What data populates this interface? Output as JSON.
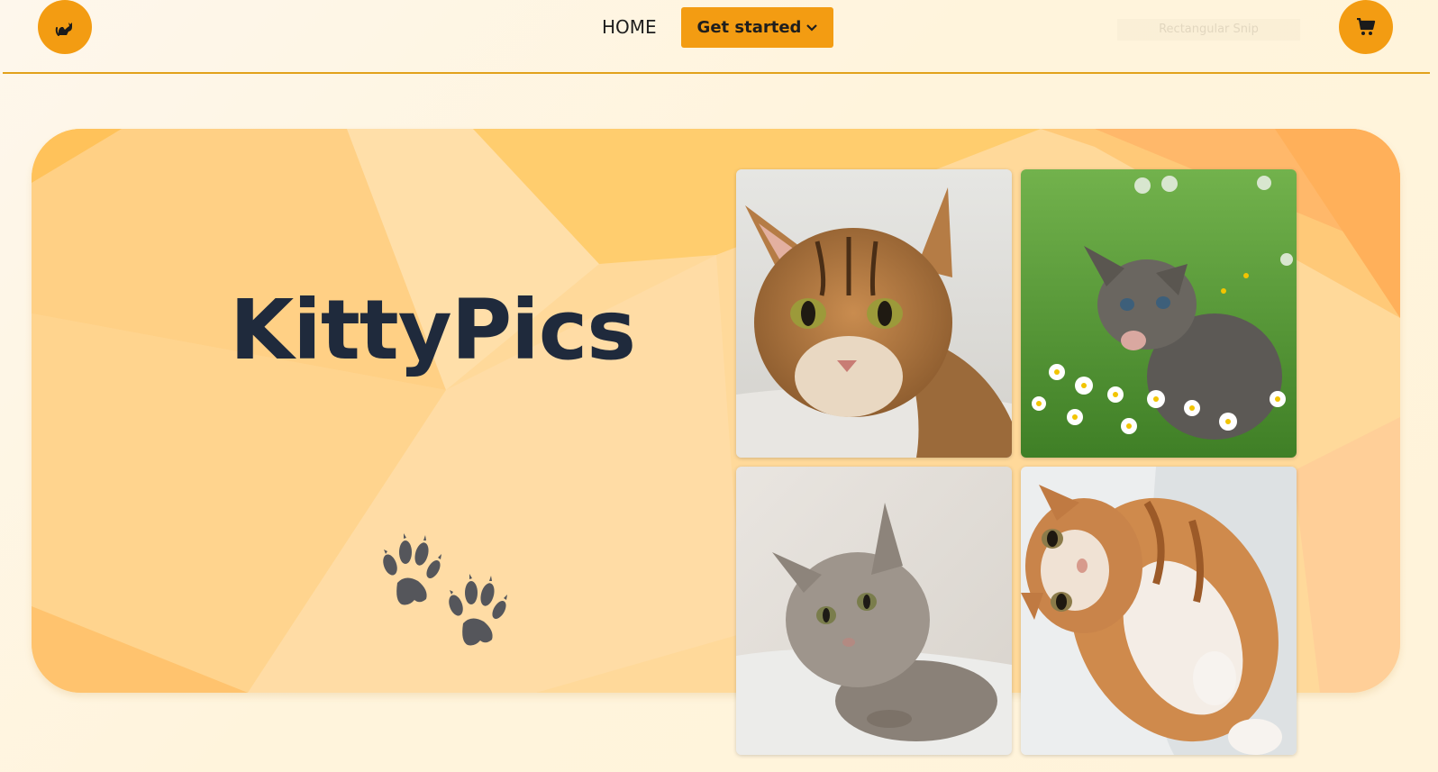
{
  "navbar": {
    "logo_icon": "cat-icon",
    "home_label": "HOME",
    "get_started_label": "Get started",
    "get_started_icon": "chevron-down-icon",
    "snip_label": "Rectangular Snip",
    "cart_icon": "cart-icon"
  },
  "hero": {
    "title": "KittyPics",
    "decoration_icon": "paw-prints-icon",
    "photos": [
      {
        "subject": "tabby-cat-photo"
      },
      {
        "subject": "kitten-in-flowers-photo"
      },
      {
        "subject": "fluffy-kitten-photo"
      },
      {
        "subject": "ginger-kitten-photo"
      }
    ]
  },
  "colors": {
    "accent": "#f39c12",
    "divider": "#e2a11b",
    "title_text": "#1f2a3c",
    "hero_base": "#ffd99a",
    "page_bg": "#fff4dc"
  }
}
